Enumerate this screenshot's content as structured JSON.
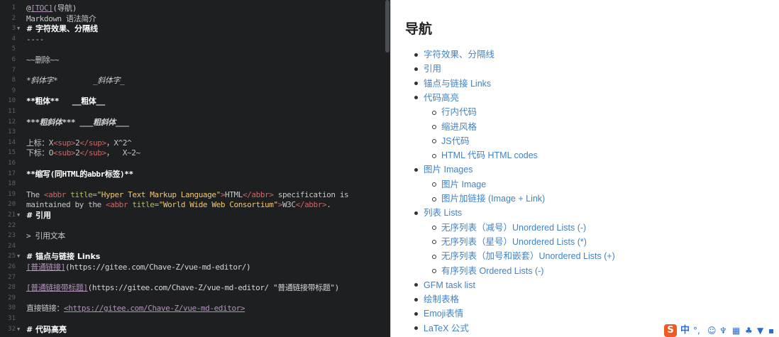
{
  "editor": {
    "lines": [
      {
        "n": "1",
        "parts": [
          {
            "c": "muted",
            "t": "@"
          },
          {
            "c": "link",
            "t": "[TOC]"
          },
          {
            "c": "muted",
            "t": "(导航)"
          }
        ]
      },
      {
        "n": "2",
        "parts": [
          {
            "c": "muted",
            "t": "Markdown 语法简介"
          }
        ]
      },
      {
        "n": "3",
        "fold": true,
        "parts": [
          {
            "c": "head",
            "t": "# 字符效果、分隔线"
          }
        ]
      },
      {
        "n": "4",
        "parts": [
          {
            "c": "muted",
            "t": "----"
          }
        ]
      },
      {
        "n": "5",
        "parts": []
      },
      {
        "n": "6",
        "parts": [
          {
            "c": "muted",
            "t": "~~删除~~"
          }
        ]
      },
      {
        "n": "7",
        "parts": []
      },
      {
        "n": "8",
        "parts": [
          {
            "c": "ital",
            "t": "*斜体字*        _斜体字_"
          }
        ]
      },
      {
        "n": "9",
        "parts": []
      },
      {
        "n": "10",
        "parts": [
          {
            "c": "bold",
            "t": "**粗体**   __粗体__"
          }
        ]
      },
      {
        "n": "11",
        "parts": []
      },
      {
        "n": "12",
        "parts": [
          {
            "c": "bold ital",
            "t": "***粗斜体*** ___粗斜体___"
          }
        ]
      },
      {
        "n": "13",
        "parts": []
      },
      {
        "n": "14",
        "parts": [
          {
            "c": "muted",
            "t": "上标：X"
          },
          {
            "c": "tag",
            "t": "<sup>"
          },
          {
            "c": "muted",
            "t": "2"
          },
          {
            "c": "tag",
            "t": "</sup>"
          },
          {
            "c": "muted",
            "t": "，X^2^"
          }
        ]
      },
      {
        "n": "15",
        "parts": [
          {
            "c": "muted",
            "t": "下标：O"
          },
          {
            "c": "tag",
            "t": "<sub>"
          },
          {
            "c": "muted",
            "t": "2"
          },
          {
            "c": "tag",
            "t": "</sub>"
          },
          {
            "c": "muted",
            "t": "，  X~2~"
          }
        ]
      },
      {
        "n": "16",
        "parts": []
      },
      {
        "n": "17",
        "parts": [
          {
            "c": "bold",
            "t": "**缩写(同HTML的abbr标签)**"
          }
        ]
      },
      {
        "n": "18",
        "parts": []
      },
      {
        "n": "19",
        "parts": [
          {
            "c": "muted",
            "t": "The "
          },
          {
            "c": "tag",
            "t": "<abbr "
          },
          {
            "c": "attr",
            "t": "title="
          },
          {
            "c": "str",
            "t": "\"Hyper Text Markup Language\""
          },
          {
            "c": "tag",
            "t": ">"
          },
          {
            "c": "muted",
            "t": "HTML"
          },
          {
            "c": "tag",
            "t": "</abbr>"
          },
          {
            "c": "muted",
            "t": " specification is"
          }
        ]
      },
      {
        "n": "20",
        "parts": [
          {
            "c": "muted",
            "t": "maintained by the "
          },
          {
            "c": "tag",
            "t": "<abbr "
          },
          {
            "c": "attr",
            "t": "title="
          },
          {
            "c": "str",
            "t": "\"World Wide Web Consortium\""
          },
          {
            "c": "tag",
            "t": ">"
          },
          {
            "c": "muted",
            "t": "W3C"
          },
          {
            "c": "tag",
            "t": "</abbr>"
          },
          {
            "c": "muted",
            "t": "."
          }
        ]
      },
      {
        "n": "21",
        "fold": true,
        "parts": [
          {
            "c": "head",
            "t": "# 引用"
          }
        ]
      },
      {
        "n": "22",
        "parts": []
      },
      {
        "n": "23",
        "parts": [
          {
            "c": "muted",
            "t": "> 引用文本"
          }
        ]
      },
      {
        "n": "24",
        "parts": []
      },
      {
        "n": "25",
        "fold": true,
        "parts": [
          {
            "c": "head",
            "t": "# 锚点与链接 Links"
          }
        ]
      },
      {
        "n": "26",
        "parts": [
          {
            "c": "link",
            "t": "[普通链接]"
          },
          {
            "c": "url",
            "t": "(https://gitee.com/Chave-Z/vue-md-editor/)"
          }
        ]
      },
      {
        "n": "27",
        "parts": []
      },
      {
        "n": "28",
        "parts": [
          {
            "c": "link",
            "t": "[普通链接带标题]"
          },
          {
            "c": "url",
            "t": "(https://gitee.com/Chave-Z/vue-md-editor/ \"普通链接带标题\")"
          }
        ]
      },
      {
        "n": "29",
        "parts": []
      },
      {
        "n": "30",
        "parts": [
          {
            "c": "muted",
            "t": "直接链接："
          },
          {
            "c": "link",
            "t": "<https://gitee.com/Chave-Z/vue-md-editor>"
          }
        ]
      },
      {
        "n": "31",
        "parts": []
      },
      {
        "n": "32",
        "fold": true,
        "parts": [
          {
            "c": "head",
            "t": "# 代码高亮"
          }
        ]
      }
    ]
  },
  "preview": {
    "title": "导航",
    "toc": [
      {
        "level": 1,
        "text": "字符效果、分隔线"
      },
      {
        "level": 1,
        "text": "引用"
      },
      {
        "level": 1,
        "text": "锚点与链接 Links"
      },
      {
        "level": 1,
        "text": "代码高亮"
      },
      {
        "level": 2,
        "text": "行内代码"
      },
      {
        "level": 2,
        "text": "缩进风格"
      },
      {
        "level": 2,
        "text": "JS代码"
      },
      {
        "level": 2,
        "text": "HTML 代码 HTML codes"
      },
      {
        "level": 1,
        "text": "图片 Images"
      },
      {
        "level": 2,
        "text": "图片 Image"
      },
      {
        "level": 2,
        "text": "图片加链接 (Image + Link)"
      },
      {
        "level": 1,
        "text": "列表 Lists"
      },
      {
        "level": 2,
        "text": "无序列表（减号）Unordered Lists (-)"
      },
      {
        "level": 2,
        "text": "无序列表（星号）Unordered Lists (*)"
      },
      {
        "level": 2,
        "text": "无序列表（加号和嵌套）Unordered Lists (+)"
      },
      {
        "level": 2,
        "text": "有序列表 Ordered Lists (-)"
      },
      {
        "level": 1,
        "text": "GFM task list"
      },
      {
        "level": 1,
        "text": "绘制表格"
      },
      {
        "level": 1,
        "text": "Emoji表情"
      },
      {
        "level": 1,
        "text": "LaTeX 公式"
      }
    ]
  },
  "ime": {
    "logo": "S",
    "lang": "中",
    "icons": [
      "punctuation-icon",
      "emoji-icon",
      "microphone-icon",
      "keyboard-icon",
      "user-icon",
      "shirt-icon",
      "grid-icon"
    ],
    "glyphs": [
      "°,",
      "☺",
      "♆",
      "▦",
      "♣",
      "▼",
      "▪"
    ],
    "logo_color": "#f05a22",
    "accent": "#2b6bd6"
  }
}
